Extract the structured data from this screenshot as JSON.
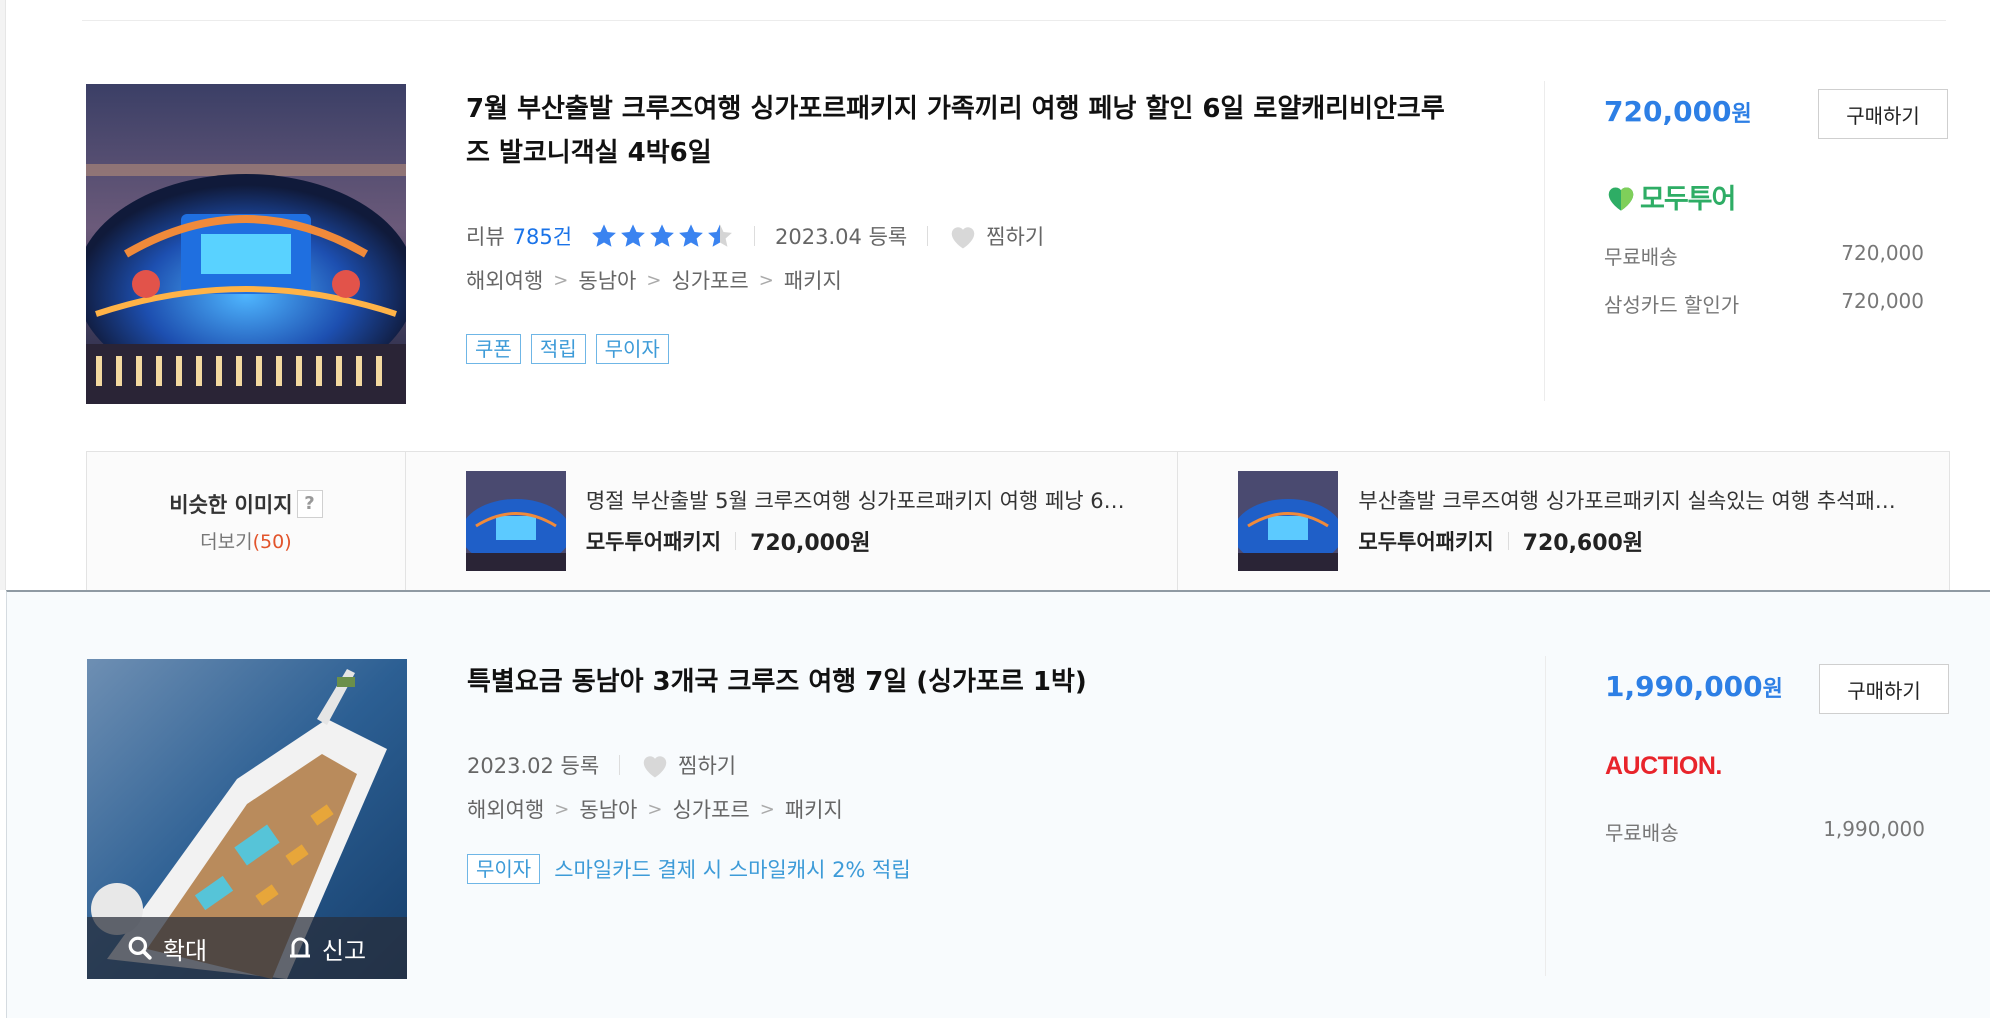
{
  "products": [
    {
      "title": "7월 부산출발 크루즈여행 싱가포르패키지 가족끼리 여행 페낭 할인 6일 로얄캐리비안크루즈 발코니객실 4박6일",
      "review_label": "리뷰",
      "review_count": "785건",
      "rating_stars": 4.5,
      "registered": "2023.04 등록",
      "wish_label": "찜하기",
      "categories": [
        "해외여행",
        "동남아",
        "싱가포르",
        "패키지"
      ],
      "crumb_sep": ">",
      "badges": [
        "쿠폰",
        "적립",
        "무이자"
      ],
      "price": "720,000",
      "currency": "원",
      "buy_label": "구매하기",
      "seller": "모두투어",
      "shipping": [
        {
          "label": "무료배송",
          "value": "720,000"
        },
        {
          "label": "삼성카드 할인가",
          "value": "720,000"
        }
      ]
    },
    {
      "title": "특별요금 동남아 3개국 크루즈 여행 7일 (싱가포르 1박)",
      "registered": "2023.02 등록",
      "wish_label": "찜하기",
      "categories": [
        "해외여행",
        "동남아",
        "싱가포르",
        "패키지"
      ],
      "crumb_sep": ">",
      "badges": [
        "무이자"
      ],
      "promo": "스마일카드 결제 시 스마일캐시 2% 적립",
      "price": "1,990,000",
      "currency": "원",
      "buy_label": "구매하기",
      "seller": "AUCTION.",
      "shipping": [
        {
          "label": "무료배송",
          "value": "1,990,000"
        }
      ],
      "overlay": {
        "zoom_label": "확대",
        "report_label": "신고"
      }
    }
  ],
  "similar": {
    "title": "비슷한 이미지",
    "help": "?",
    "more_label": "더보기",
    "more_count": "(50)",
    "items": [
      {
        "name": "명절 부산출발 5월 크루즈여행 싱가포르패키지 여행 페낭 6…",
        "seller": "모두투어패키지",
        "price": "720,000원"
      },
      {
        "name": "부산출발 크루즈여행 싱가포르패키지 실속있는 여행 추석패…",
        "seller": "모두투어패키지",
        "price": "720,600원"
      }
    ]
  },
  "colors": {
    "accent": "#2d7fe5",
    "badge": "#3d9bd8",
    "modu_green": "#2ead65",
    "auction_red": "#e8242b"
  }
}
